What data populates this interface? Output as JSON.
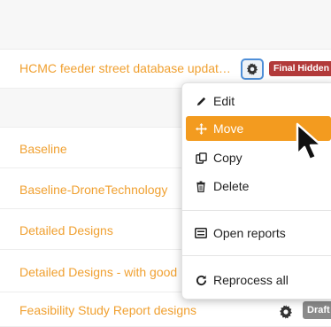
{
  "rows": [
    {
      "label": "HCMC feeder street database updat…",
      "badge": "Final Hidden"
    },
    {
      "label": "Baseline"
    },
    {
      "label": "Baseline-DroneTechnology"
    },
    {
      "label": "Detailed Designs"
    },
    {
      "label": "Detailed Designs - with good"
    },
    {
      "label": "Feasibility Study Report designs",
      "badge": "Draft"
    }
  ],
  "context_menu": {
    "items": [
      {
        "label": "Edit",
        "icon": "pencil-icon"
      },
      {
        "label": "Move",
        "icon": "move-icon",
        "active": true
      },
      {
        "label": "Copy",
        "icon": "copy-icon"
      },
      {
        "label": "Delete",
        "icon": "trash-icon"
      },
      {
        "label": "Open reports",
        "icon": "report-icon"
      },
      {
        "label": "Reprocess all",
        "icon": "refresh-icon"
      }
    ]
  },
  "colors": {
    "link_orange": "#f0a030",
    "menu_active": "#f39b1f",
    "badge_red": "#b23a3a",
    "badge_grey": "#8a8a8a",
    "focus_blue": "#4f8fd8"
  }
}
